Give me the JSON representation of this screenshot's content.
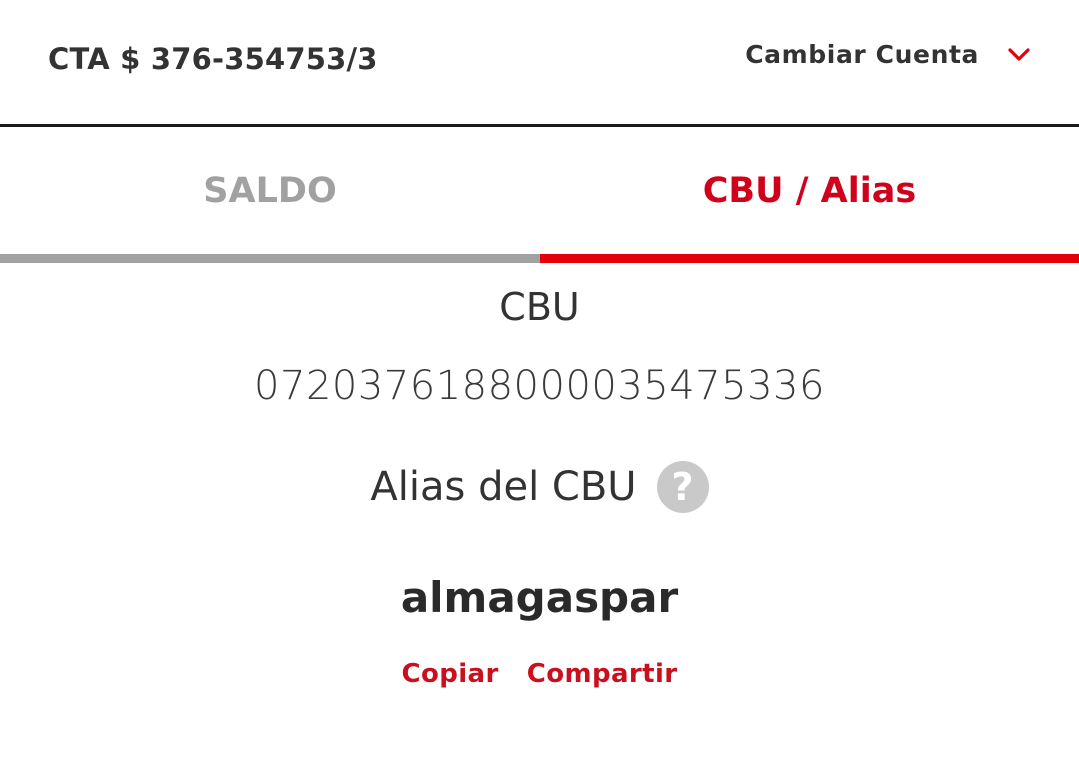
{
  "header": {
    "account_label": "CTA $ 376-354753/3",
    "change_account_label": "Cambiar Cuenta",
    "chevron_icon": "chevron-down-icon"
  },
  "tabs": [
    {
      "label": "SALDO",
      "active": false
    },
    {
      "label": "CBU / Alias",
      "active": true
    }
  ],
  "cbu": {
    "heading": "CBU",
    "number": "0720376188000035475336"
  },
  "alias": {
    "heading": "Alias del CBU",
    "help_icon_glyph": "?",
    "value": "almagaspar"
  },
  "actions": {
    "copy_label": "Copiar",
    "share_label": "Compartir"
  },
  "colors": {
    "accent": "#e3000b",
    "accent_text": "#d0021b",
    "inactive_tab": "#a1a1a1",
    "help_icon_bg": "#c9c9c9"
  }
}
